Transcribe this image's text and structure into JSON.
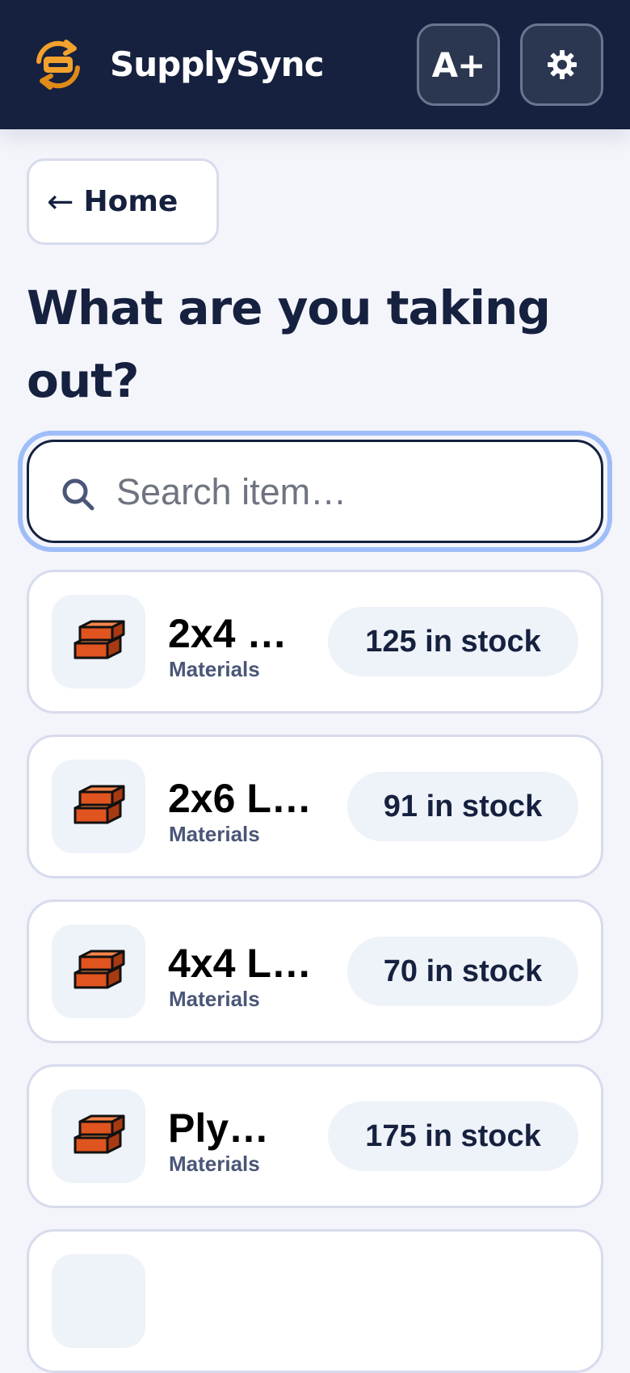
{
  "header": {
    "app_title": "SupplySync",
    "logo_icon": "sync-logo-icon",
    "text_size_label": "A+",
    "settings_icon": "gear-icon",
    "accent_color": "#f2a12c",
    "bar_color": "#16213f"
  },
  "nav": {
    "back_label": "Home",
    "back_icon": "arrow-left-icon"
  },
  "page": {
    "title": "What are you taking out?"
  },
  "search": {
    "placeholder": "Search item…",
    "value": "",
    "icon": "search-icon"
  },
  "items": [
    {
      "name": "2x4 …",
      "category": "Materials",
      "stock": "125 in stock",
      "icon": "lumber-icon"
    },
    {
      "name": "2x6 L…",
      "category": "Materials",
      "stock": "91 in stock",
      "icon": "lumber-icon"
    },
    {
      "name": "4x4 L…",
      "category": "Materials",
      "stock": "70 in stock",
      "icon": "lumber-icon"
    },
    {
      "name": "Ply…",
      "category": "Materials",
      "stock": "175 in stock",
      "icon": "lumber-icon"
    }
  ]
}
